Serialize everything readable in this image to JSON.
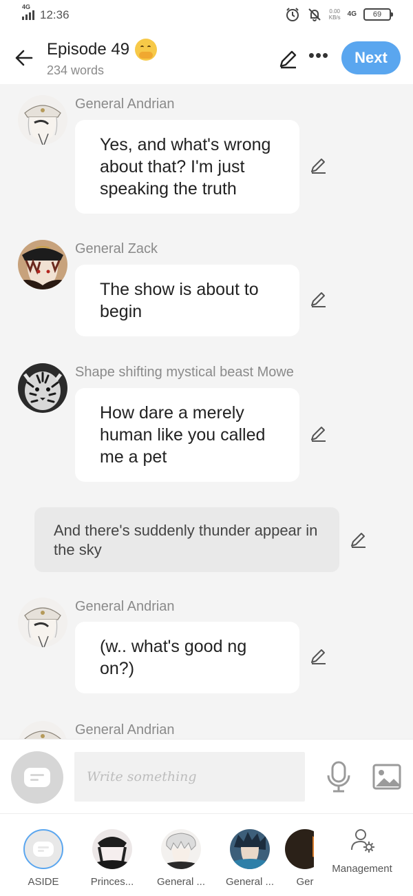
{
  "status_bar": {
    "network": "4G",
    "time": "12:36",
    "speed": "0.00",
    "speed_unit": "KB/s",
    "network2": "4G",
    "battery": "69"
  },
  "header": {
    "title": "Episode 49",
    "title_emoji": "hand-over-mouth-emoji",
    "word_count": "234 words",
    "next_label": "Next"
  },
  "messages": [
    {
      "type": "dialogue",
      "speaker": "General Andrian",
      "text": "Yes, and what's wrong about that? I'm just speaking the truth",
      "avatar": "general-andrian"
    },
    {
      "type": "dialogue",
      "speaker": "General Zack",
      "text": "The show is about to begin",
      "avatar": "general-zack"
    },
    {
      "type": "dialogue",
      "speaker": "Shape shifting mystical beast Mowe",
      "text": "How dare a merely human like you called me a pet",
      "avatar": "tiger"
    },
    {
      "type": "narration",
      "text": "And there's suddenly thunder appear in the sky"
    },
    {
      "type": "dialogue",
      "speaker": "General Andrian",
      "text": "(w.. what's good ng on?)",
      "avatar": "general-andrian"
    },
    {
      "type": "dialogue",
      "speaker": "General Andrian",
      "text": "",
      "avatar": "general-andrian"
    }
  ],
  "composer": {
    "placeholder": "Write something"
  },
  "cast": [
    {
      "label": "ASIDE"
    },
    {
      "label": "Princes..."
    },
    {
      "label": "General ..."
    },
    {
      "label": "General ..."
    },
    {
      "label": "Ger"
    }
  ],
  "management_label": "Management",
  "colors": {
    "accent": "#5aa6ef",
    "background": "#f4f4f4",
    "bubble": "#ffffff",
    "narration": "#e9e9e9"
  }
}
